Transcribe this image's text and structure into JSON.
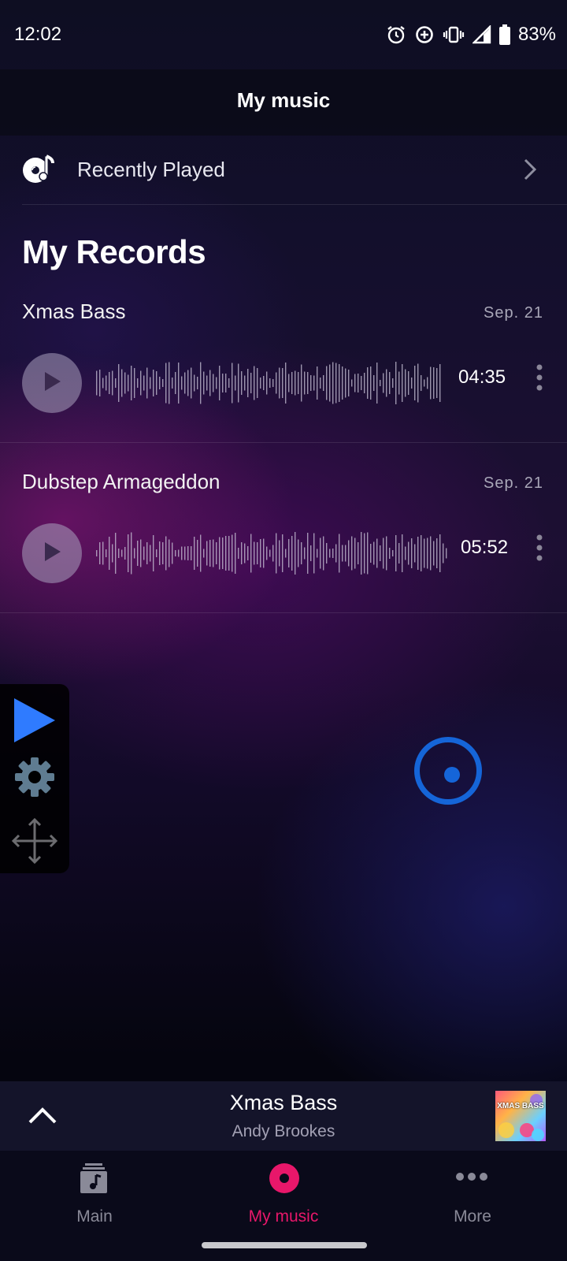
{
  "status_bar": {
    "time": "12:02",
    "battery": "83%",
    "icons": [
      "alarm-icon",
      "data-saver-icon",
      "vibrate-icon",
      "signal-icon",
      "battery-icon"
    ]
  },
  "header": {
    "title": "My music"
  },
  "recently_played": {
    "label": "Recently Played",
    "icon": "music-disc-icon"
  },
  "records": {
    "heading": "My Records",
    "items": [
      {
        "title": "Xmas Bass",
        "date": "Sep. 21",
        "duration": "04:35"
      },
      {
        "title": "Dubstep Armageddon",
        "date": "Sep. 21",
        "duration": "05:52"
      }
    ]
  },
  "tool_panel": {
    "icons": [
      "play-icon",
      "gear-icon",
      "move-icon"
    ]
  },
  "mini_player": {
    "title": "Xmas Bass",
    "artist": "Andy Brookes",
    "art_text": "XMAS BASS"
  },
  "bottom_nav": {
    "items": [
      {
        "label": "Main",
        "icon": "music-file-icon",
        "active": false
      },
      {
        "label": "My music",
        "icon": "record-icon",
        "active": true
      },
      {
        "label": "More",
        "icon": "more-dots-icon",
        "active": false
      }
    ]
  },
  "colors": {
    "accent": "#e8176a",
    "target_blue": "#1565d8",
    "tool_play": "#2f7bff"
  }
}
